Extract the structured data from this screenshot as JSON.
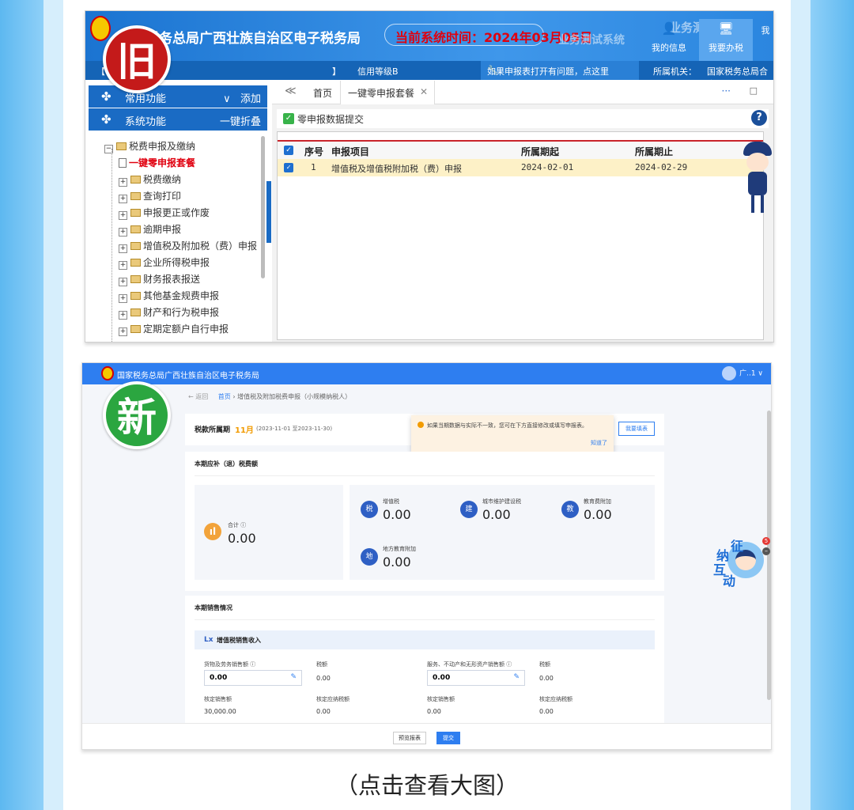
{
  "old": {
    "badge": "旧",
    "title": "税务总局广西壮族自治区电子税务局",
    "system_time": "当前系统时间：2024年03月05日",
    "watermark": "业务测试系统",
    "nav": [
      {
        "icon": "user-icon",
        "label": "我的信息"
      },
      {
        "icon": "monitor-icon",
        "label": "我要办税"
      },
      {
        "icon": "more-icon",
        "label": "我"
      }
    ],
    "bar": {
      "bracket_l": "【",
      "bracket_r": "】",
      "credit": "信用等级B",
      "help": "如果申报表打开有问题，点这里",
      "org_label": "所属机关：",
      "org": "国家税务总局合山"
    },
    "sidebar": {
      "common": {
        "label": "常用功能",
        "action": "添加",
        "arrow": "∨"
      },
      "system": {
        "label": "系统功能",
        "action": "一键折叠"
      },
      "tree_root": "税费申报及缴纳",
      "tree_selected": "一键零申报套餐",
      "tree_items": [
        "税费缴纳",
        "查询打印",
        "申报更正或作废",
        "逾期申报",
        "增值税及附加税（费）申报",
        "企业所得税申报",
        "财务报表报送",
        "其他基金规费申报",
        "财产和行为税申报",
        "定期定额户自行申报"
      ]
    },
    "tabs": {
      "collapse": "≪",
      "home": "首页",
      "active": "一键零申报套餐",
      "close": "✕",
      "more": "···",
      "max": "□"
    },
    "toolbar": {
      "submit": "零申报数据提交",
      "help": "?"
    },
    "table": {
      "headers": [
        "序号",
        "申报项目",
        "所属期起",
        "所属期止"
      ],
      "rows": [
        {
          "no": "1",
          "item": "增值税及增值税附加税（费）申报",
          "start": "2024-02-01",
          "end": "2024-02-29"
        }
      ]
    }
  },
  "new": {
    "badge": "新",
    "header_title": "国家税务总局广西壮族自治区电子税务局",
    "user": "广..1 ∨",
    "breadcrumb": {
      "back": "← 返回",
      "home": "首页",
      "sep": "›",
      "current": "增值税及附加税费申报（小规模纳税人）"
    },
    "period": {
      "label": "税款所属期",
      "month": "11月",
      "range": "(2023-11-01 至2023-11-30)",
      "button": "我要填表"
    },
    "tip": {
      "text": "如果当期数据与实际不一致，您可在下方直接修改或填写申报表。",
      "ok": "知道了"
    },
    "section1": {
      "title": "本期应补（退）税费额",
      "total": {
        "label": "合计 ⓘ",
        "value": "0.00"
      },
      "taxes": [
        {
          "icon": "tax-icon",
          "icon_text": "税",
          "label": "增值税",
          "value": "0.00"
        },
        {
          "icon": "building-icon",
          "icon_text": "建",
          "label": "城市维护建设税",
          "value": "0.00"
        },
        {
          "icon": "graduation-icon",
          "icon_text": "教",
          "label": "教育费附加",
          "value": "0.00"
        },
        {
          "icon": "book-icon",
          "icon_text": "地",
          "label": "地方教育附加",
          "value": "0.00"
        }
      ]
    },
    "section2": {
      "title": "本期销售情况",
      "sub_title": "增值税销售收入",
      "sub_icon": "Lx",
      "fields": [
        {
          "label": "货物及劳务销售额 ⓘ",
          "value": "0.00",
          "editable": true
        },
        {
          "label": "税额",
          "value": "0.00"
        },
        {
          "label": "服务、不动产和无形资产销售额 ⓘ",
          "value": "0.00",
          "editable": true
        },
        {
          "label": "税额",
          "value": "0.00"
        }
      ],
      "verified": [
        {
          "label": "核定销售额",
          "value": "30,000.00"
        },
        {
          "label": "核定应纳税额",
          "value": "0.00"
        },
        {
          "label": "核定销售额",
          "value": "0.00"
        },
        {
          "label": "核定应纳税额",
          "value": "0.00"
        }
      ]
    },
    "footer": {
      "preview": "预览报表",
      "submit": "提交"
    },
    "mascot": {
      "c1": "征",
      "c2": "纳",
      "c3": "互",
      "c4": "动",
      "count": "5",
      "minus": "–"
    }
  },
  "caption": "（点击查看大图）"
}
